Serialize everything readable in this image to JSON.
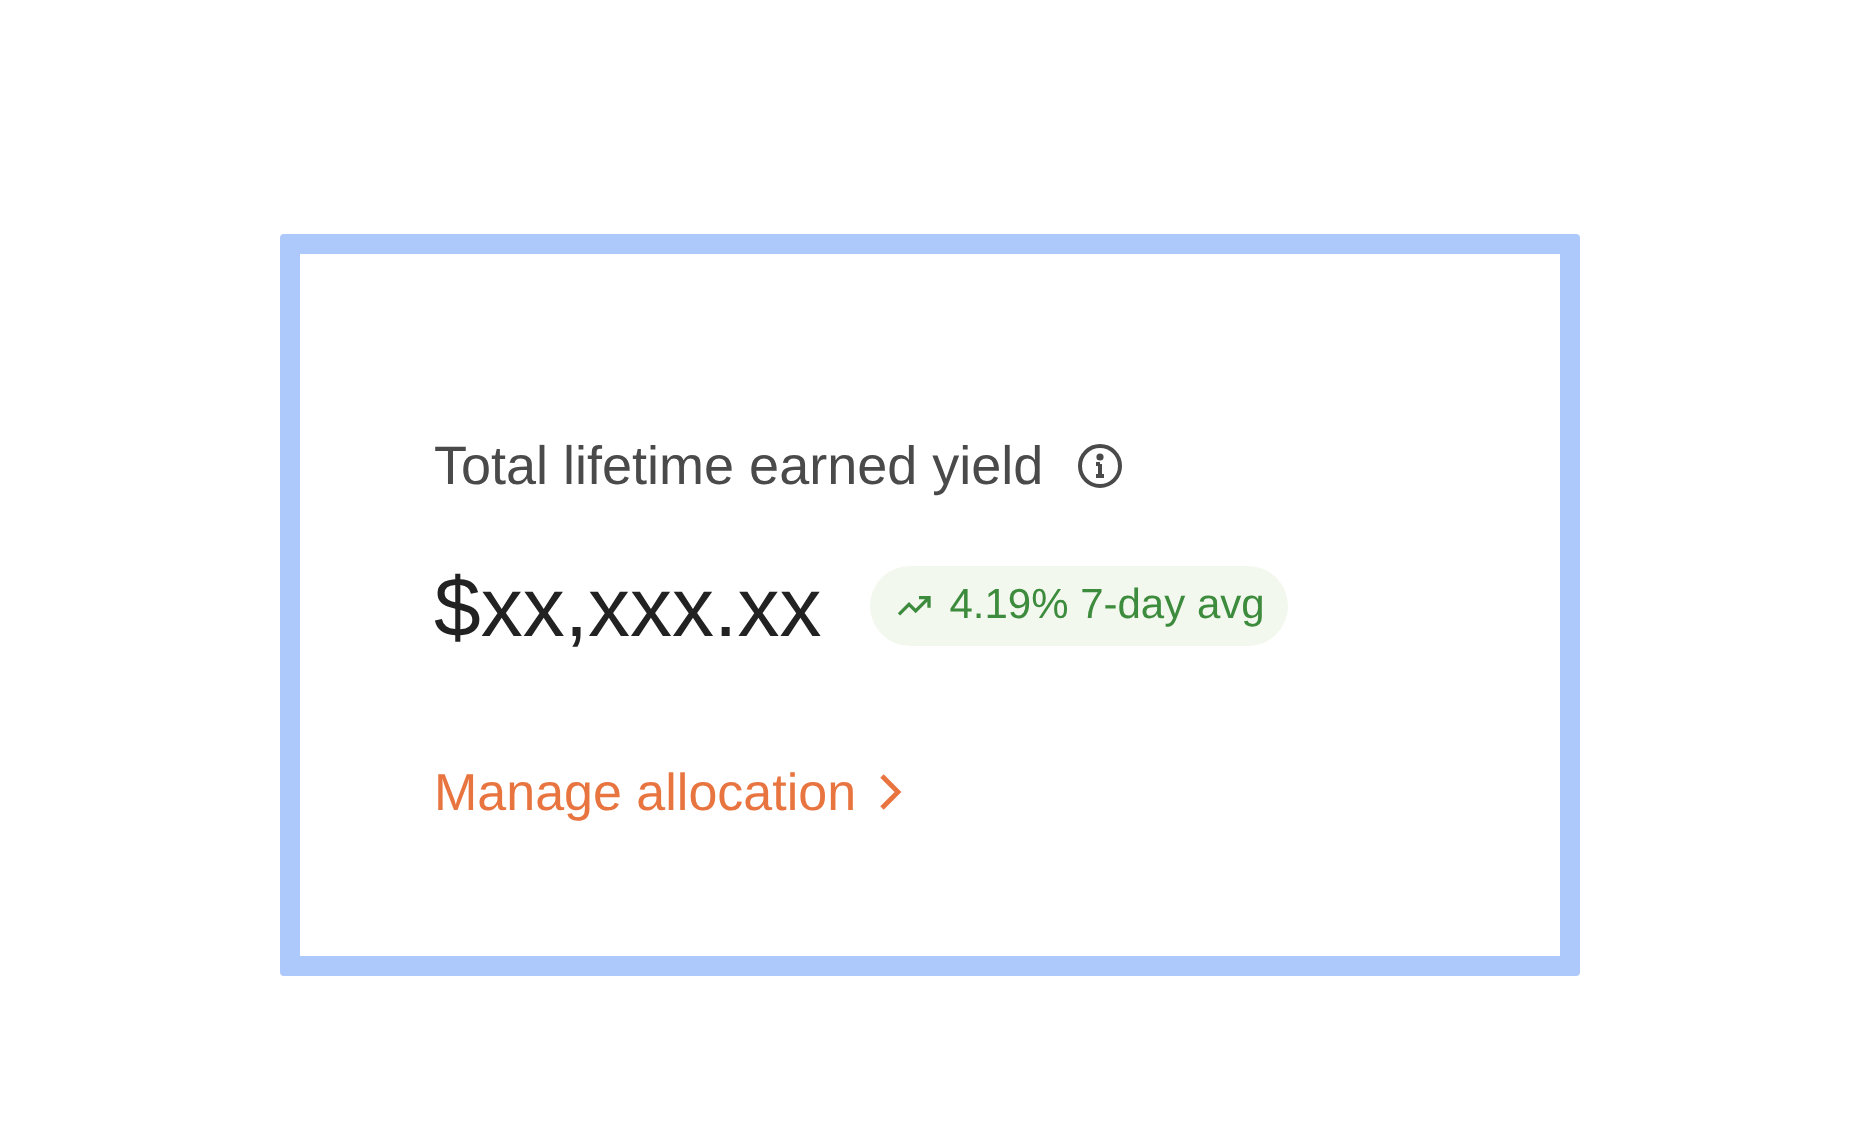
{
  "card": {
    "title": "Total lifetime earned yield",
    "amount": "$xx,xxx.xx",
    "badge": {
      "text": "4.19% 7-day avg"
    },
    "link": "Manage allocation"
  }
}
